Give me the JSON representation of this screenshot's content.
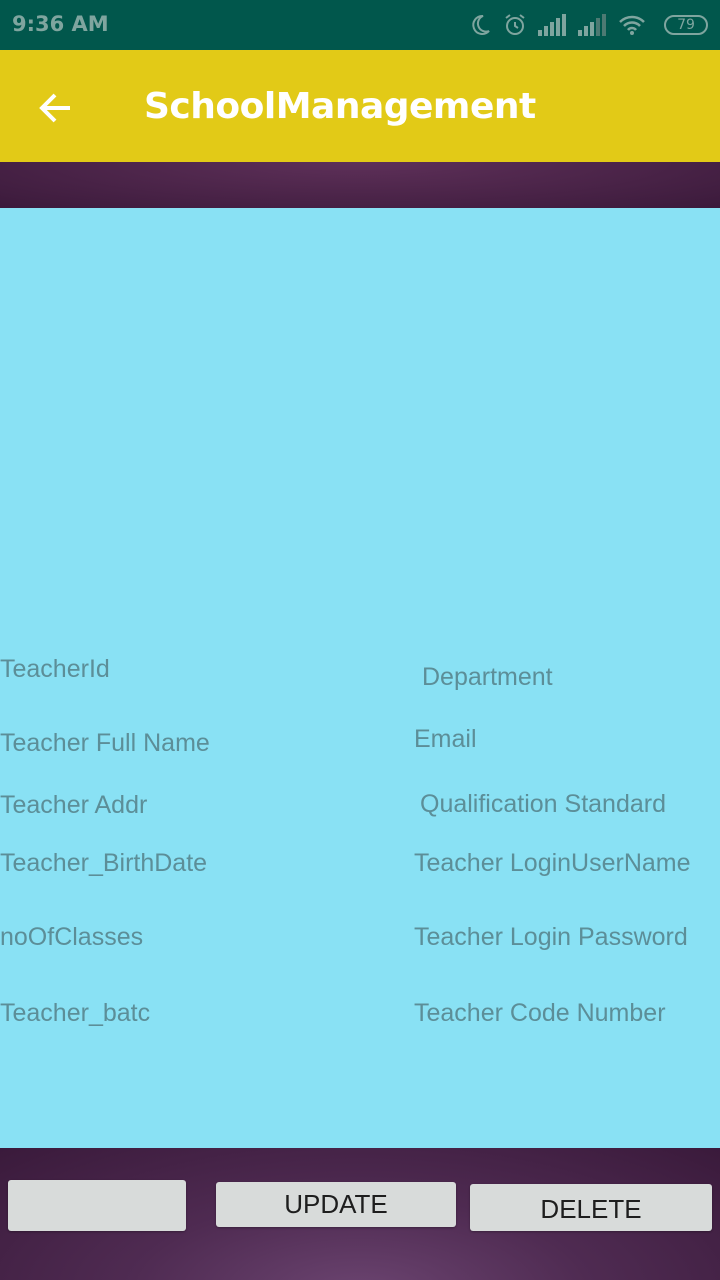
{
  "status_bar": {
    "time": "9:36 AM",
    "battery": "79",
    "icons": [
      "moon-icon",
      "alarm-icon",
      "signal-icon",
      "signal-weak-icon",
      "wifi-icon",
      "battery-icon"
    ]
  },
  "app_bar": {
    "back_icon": "arrow-back-icon",
    "title": "SchoolManagement"
  },
  "form": {
    "left": {
      "teacher_id": "TeacherId",
      "full_name": "Teacher Full Name",
      "address": "Teacher Addr",
      "birth_date": "Teacher_BirthDate",
      "no_of_classes": "noOfClasses",
      "batch": "Teacher_batc"
    },
    "right": {
      "department": "Department",
      "email": "Email",
      "qualification": "Qualification Standard",
      "login_username": "Teacher LoginUserName",
      "login_password": "Teacher Login Password",
      "code_number": "Teacher Code Number"
    }
  },
  "buttons": {
    "first": "",
    "update": "UPDATE",
    "delete": "DELETE"
  },
  "colors": {
    "status_bar": "#01574c",
    "app_bar": "#e2ca17",
    "form_background": "#89e1f4",
    "hint_text": "#5c8e98",
    "button": "#d8dbda",
    "bottom_background": "#4f2b52"
  }
}
